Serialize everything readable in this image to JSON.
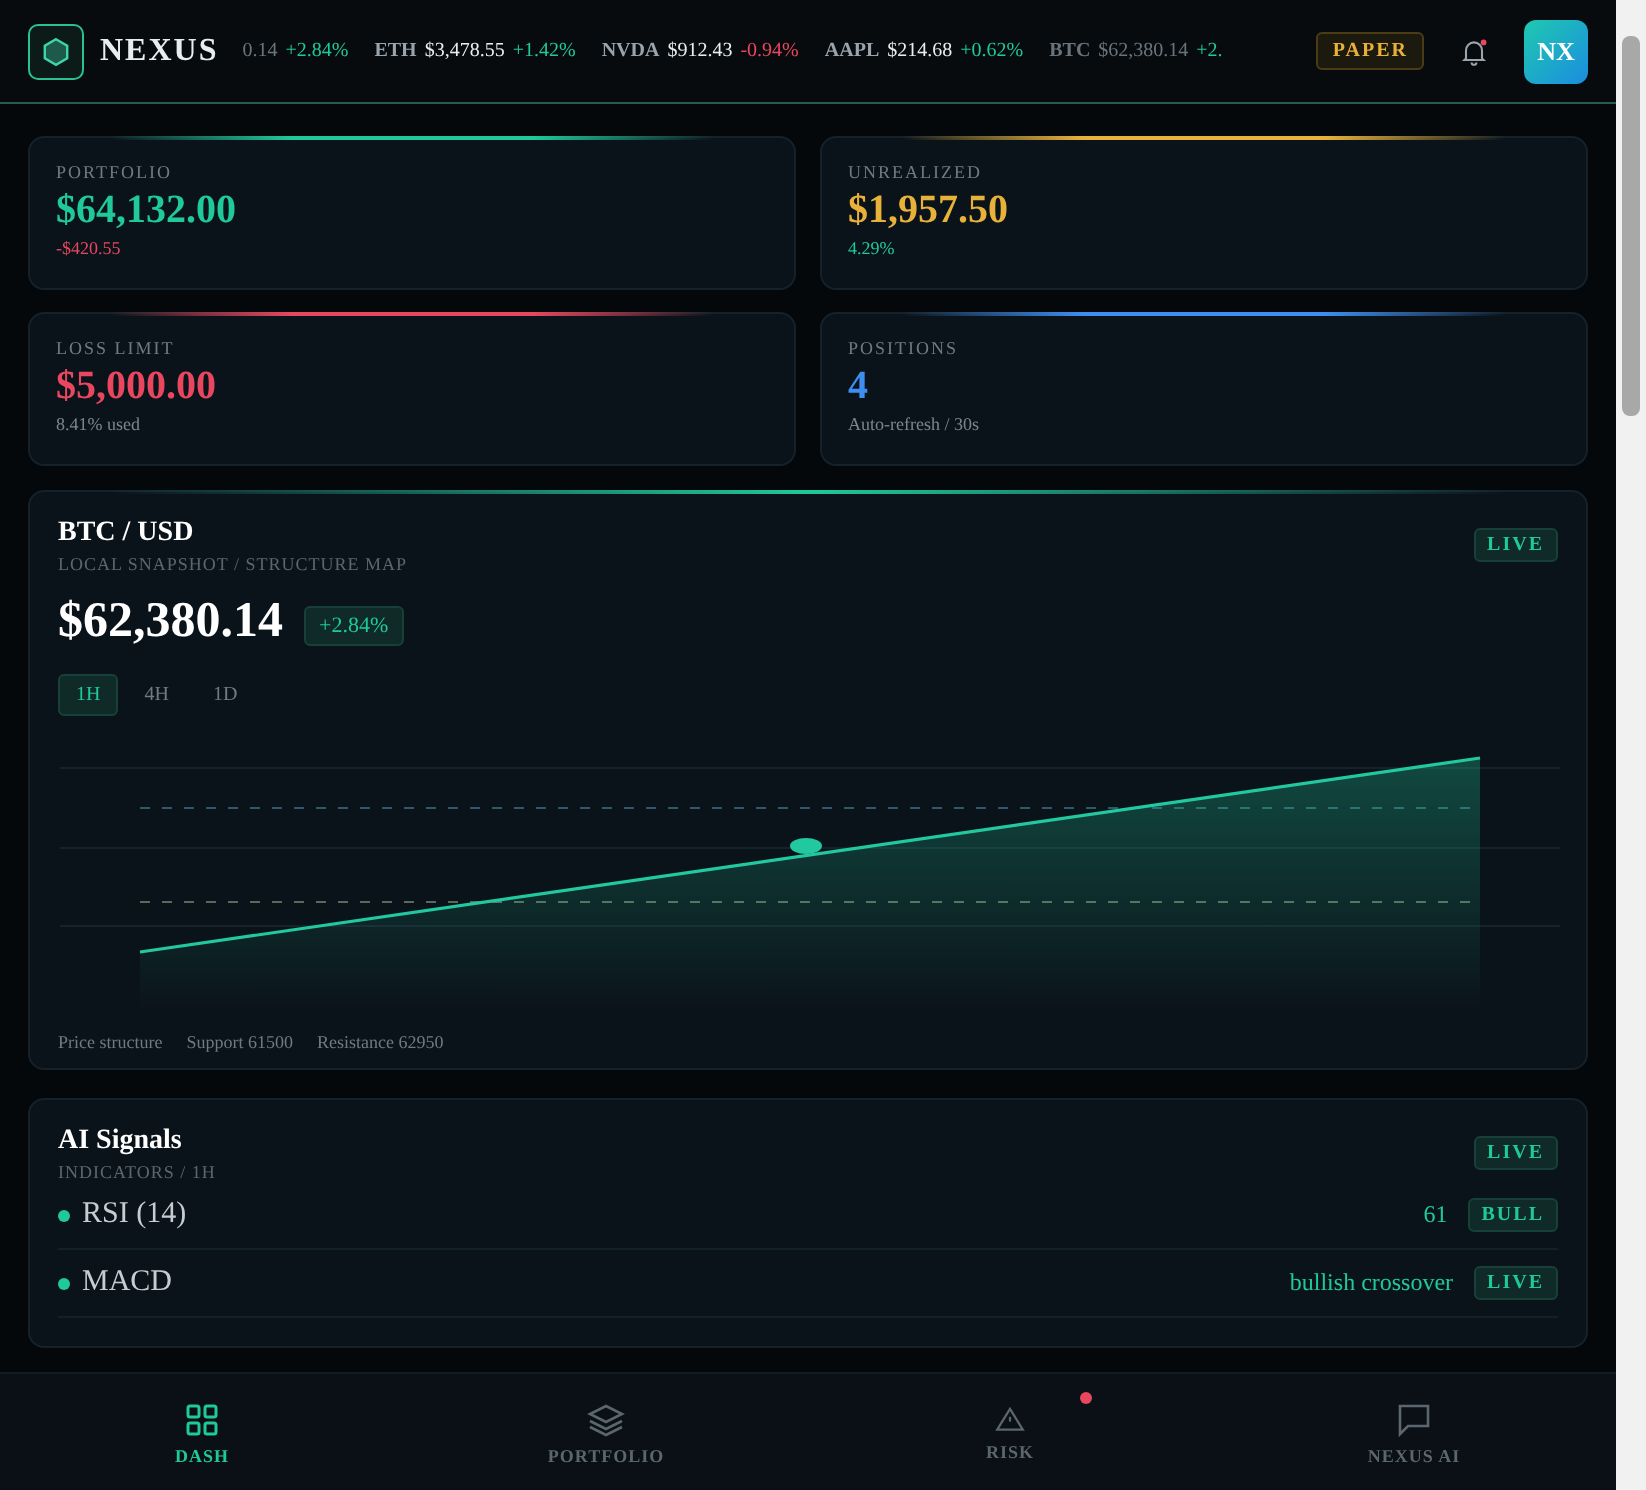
{
  "header": {
    "brand": "NEXUS",
    "ticker": [
      {
        "price": "0.14",
        "change": "+2.84%",
        "color": "#1fc99a",
        "faded": true
      },
      {
        "symbol": "ETH",
        "price": "$3,478.55",
        "change": "+1.42%",
        "color": "#1fc99a",
        "faded": false
      },
      {
        "symbol": "NVDA",
        "price": "$912.43",
        "change": "-0.94%",
        "color": "#e8475f",
        "faded": false
      },
      {
        "symbol": "AAPL",
        "price": "$214.68",
        "change": "+0.62%",
        "color": "#1fc99a",
        "faded": false
      },
      {
        "symbol": "BTC",
        "price": "$62,380.14",
        "change": "+2.",
        "color": "#1fc99a",
        "faded": true
      }
    ],
    "mode_badge": "PAPER",
    "bell": {
      "unread": true
    },
    "avatar": "NX"
  },
  "stats": [
    {
      "label": "PORTFOLIO",
      "value": "$64,132.00",
      "sub": {
        "text": "-$420.55",
        "color": "#e8475f"
      },
      "color": "#1fc99a"
    },
    {
      "label": "UNREALIZED",
      "value": "$1,957.50",
      "sub": {
        "text": "4.29%",
        "color": "#1fc99a"
      },
      "color": "#e8b23a"
    },
    {
      "label": "LOSS LIMIT",
      "value": "$5,000.00",
      "sub": {
        "text": "8.41% used",
        "color": "#7c868f"
      },
      "color": "#e8475f"
    },
    {
      "label": "POSITIONS",
      "value": "4",
      "sub": {
        "text": "Auto-refresh / 30s",
        "color": "#7c868f"
      },
      "color": "#3d8ef0"
    }
  ],
  "market": {
    "title": "BTC / USD",
    "subtitle": "LOCAL SNAPSHOT / STRUCTURE MAP",
    "status": "LIVE",
    "price": "$62,380.14",
    "change": "+2.84%",
    "timeframes": [
      {
        "label": "1H",
        "selected": true
      },
      {
        "label": "4H",
        "selected": false
      },
      {
        "label": "1D",
        "selected": false
      }
    ],
    "legend": [
      "Price structure",
      "Support 61500",
      "Resistance 62950"
    ]
  },
  "signals": {
    "title": "AI Signals",
    "subtitle": "INDICATORS / 1H",
    "status": "LIVE",
    "items": [
      {
        "name": "RSI (14)",
        "value": "61",
        "badge": "BULL"
      },
      {
        "name": "MACD",
        "value": "bullish crossover",
        "badge": "LIVE"
      }
    ]
  },
  "nav": [
    {
      "label": "DASH",
      "selected": true,
      "alert": false
    },
    {
      "label": "PORTFOLIO",
      "selected": false,
      "alert": false
    },
    {
      "label": "RISK",
      "selected": false,
      "alert": true
    },
    {
      "label": "NEXUS AI",
      "selected": false,
      "alert": false
    }
  ]
}
